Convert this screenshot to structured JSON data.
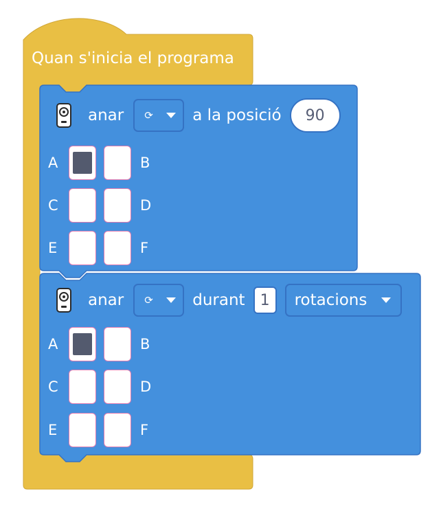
{
  "hat": {
    "label": "Quan s'inicia el programa"
  },
  "block1": {
    "verb": "anar",
    "direction_icon": "clockwise-arrow-icon",
    "direction_glyph": "⟳",
    "suffix": "a la posició",
    "position_value": "90",
    "ports": [
      {
        "letter": "A",
        "selected": true
      },
      {
        "letter": "B",
        "selected": false
      },
      {
        "letter": "C",
        "selected": false
      },
      {
        "letter": "D",
        "selected": false
      },
      {
        "letter": "E",
        "selected": false
      },
      {
        "letter": "F",
        "selected": false
      }
    ]
  },
  "block2": {
    "verb": "anar",
    "direction_icon": "clockwise-arrow-icon",
    "direction_glyph": "⟳",
    "middle": "durant",
    "amount_value": "1",
    "unit": "rotacions",
    "ports": [
      {
        "letter": "A",
        "selected": true
      },
      {
        "letter": "B",
        "selected": false
      },
      {
        "letter": "C",
        "selected": false
      },
      {
        "letter": "D",
        "selected": false
      },
      {
        "letter": "E",
        "selected": false
      },
      {
        "letter": "F",
        "selected": false
      }
    ]
  },
  "colors": {
    "event_yellow": "#e9bf44",
    "motor_blue": "#4490dd",
    "motor_blue_border": "#3572c3",
    "selected_port": "#535a6e"
  }
}
